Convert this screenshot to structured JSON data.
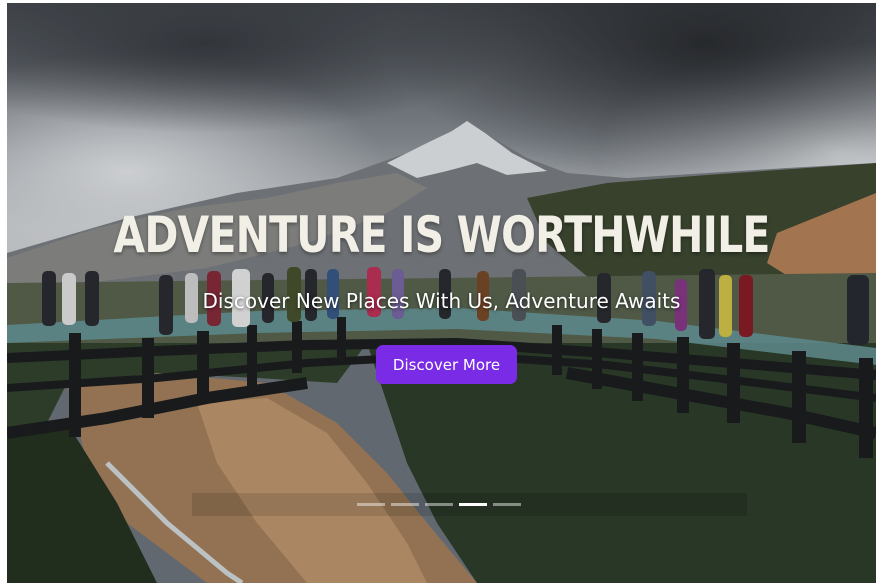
{
  "hero": {
    "title": "ADVENTURE IS WORTHWHILE",
    "subtitle": "Discover New Places With Us, Adventure Awaits",
    "cta_label": "Discover More",
    "cta_color": "#7a2be6",
    "background_image": "glacier skywalk over mountain valley"
  },
  "slider": {
    "slide_count": 5,
    "active_index": 3
  }
}
